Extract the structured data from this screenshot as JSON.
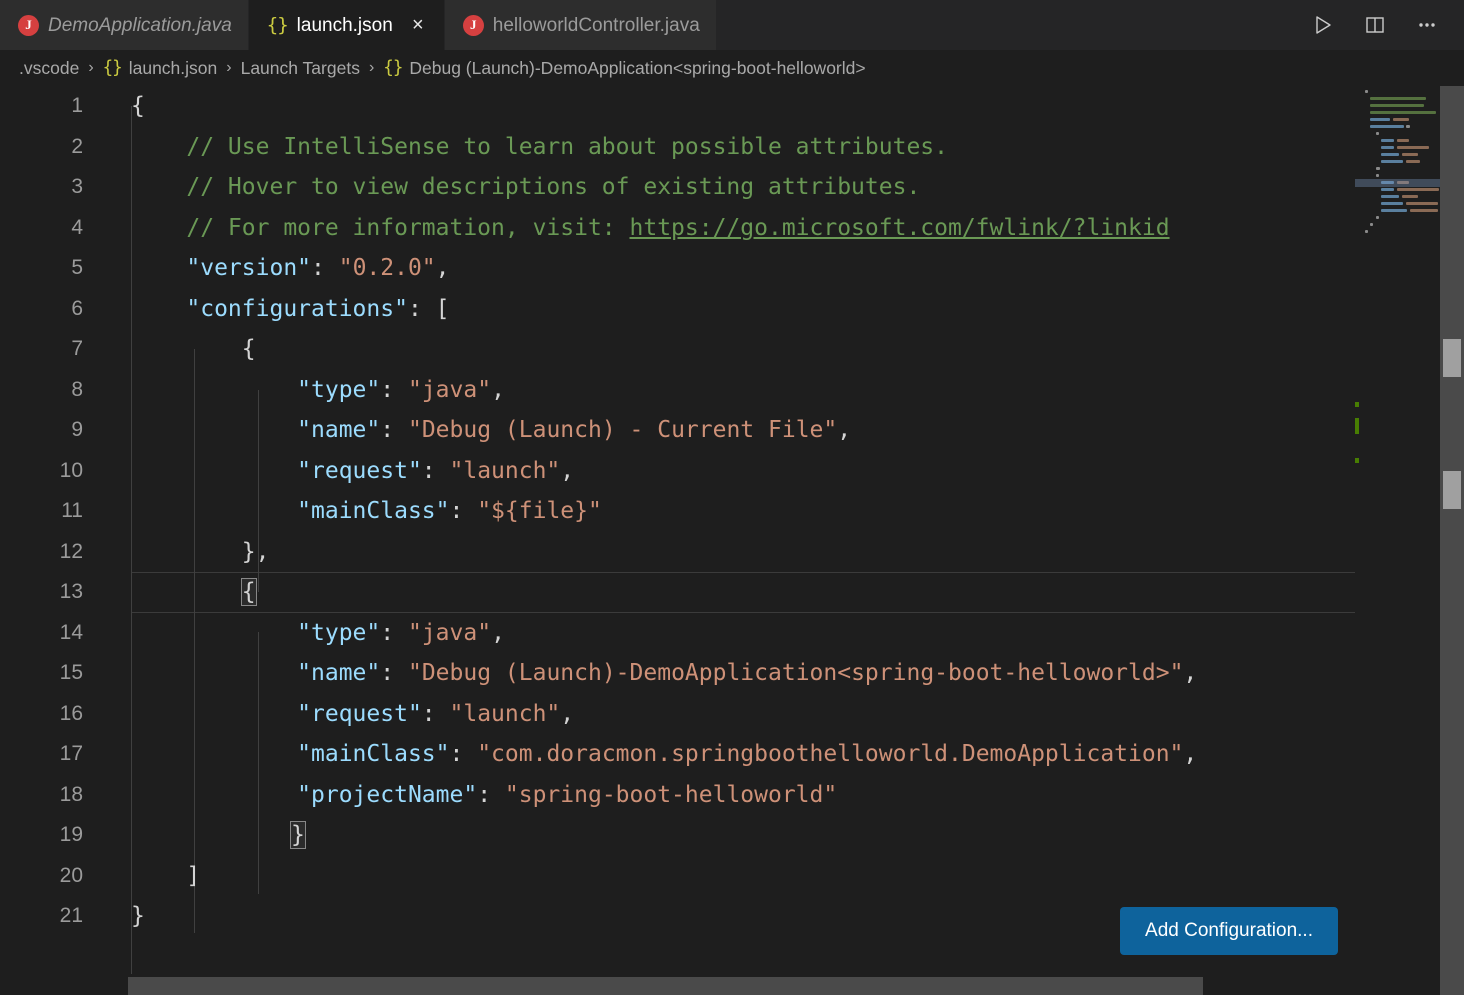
{
  "tabs": [
    {
      "label": "DemoApplication.java",
      "icon": "java-icon",
      "state": "preview",
      "closable": false
    },
    {
      "label": "launch.json",
      "icon": "json-icon",
      "state": "active",
      "closable": true,
      "close_glyph": "×"
    },
    {
      "label": "helloworldController.java",
      "icon": "java-icon",
      "state": "inactive",
      "closable": false
    }
  ],
  "tab_actions": [
    {
      "name": "run-button",
      "glyph": "▷"
    },
    {
      "name": "split-editor-button",
      "glyph": "□"
    },
    {
      "name": "more-actions-button",
      "glyph": "⋯"
    }
  ],
  "breadcrumb": {
    "separator": "›",
    "items": [
      {
        "label": ".vscode",
        "icon": ""
      },
      {
        "label": "launch.json",
        "icon": "{}"
      },
      {
        "label": "Launch Targets",
        "icon": ""
      },
      {
        "label": "Debug (Launch)-DemoApplication<spring-boot-helloworld>",
        "icon": "{}"
      }
    ]
  },
  "editor": {
    "language": "json",
    "current_line": 13,
    "lines": [
      {
        "n": "1",
        "text": "{"
      },
      {
        "n": "2",
        "text": "    // Use IntelliSense to learn about possible attributes."
      },
      {
        "n": "3",
        "text": "    // Hover to view descriptions of existing attributes."
      },
      {
        "n": "4",
        "text": "    // For more information, visit: https://go.microsoft.com/fwlink/?linkid"
      },
      {
        "n": "5",
        "text": "    \"version\": \"0.2.0\","
      },
      {
        "n": "6",
        "text": "    \"configurations\": ["
      },
      {
        "n": "7",
        "text": "        {"
      },
      {
        "n": "8",
        "text": "            \"type\": \"java\","
      },
      {
        "n": "9",
        "text": "            \"name\": \"Debug (Launch) - Current File\","
      },
      {
        "n": "10",
        "text": "            \"request\": \"launch\","
      },
      {
        "n": "11",
        "text": "            \"mainClass\": \"${file}\""
      },
      {
        "n": "12",
        "text": "        },"
      },
      {
        "n": "13",
        "text": "        {"
      },
      {
        "n": "14",
        "text": "            \"type\": \"java\","
      },
      {
        "n": "15",
        "text": "            \"name\": \"Debug (Launch)-DemoApplication<spring-boot-helloworld>\","
      },
      {
        "n": "16",
        "text": "            \"request\": \"launch\","
      },
      {
        "n": "17",
        "text": "            \"mainClass\": \"com.doracmon.springboothelloworld.DemoApplication\","
      },
      {
        "n": "18",
        "text": "            \"projectName\": \"spring-boot-helloworld\""
      },
      {
        "n": "19",
        "text": "        }"
      },
      {
        "n": "20",
        "text": "    ]"
      },
      {
        "n": "21",
        "text": "}"
      }
    ],
    "url_text": "https://go.microsoft.com/fwlink/?linkid"
  },
  "add_configuration": {
    "label": "Add Configuration..."
  },
  "colors": {
    "editor_background": "#1e1e1e",
    "tabbar_background": "#252526",
    "inactive_tab_background": "#2d2d2d",
    "button_background": "#0e639c",
    "comment": "#6a9955",
    "property_key": "#9cdcfe",
    "string_value": "#ce9178",
    "java_icon": "#d64040",
    "json_icon": "#cbcb41",
    "scrollbar_thumb": "#a0a0a0"
  }
}
